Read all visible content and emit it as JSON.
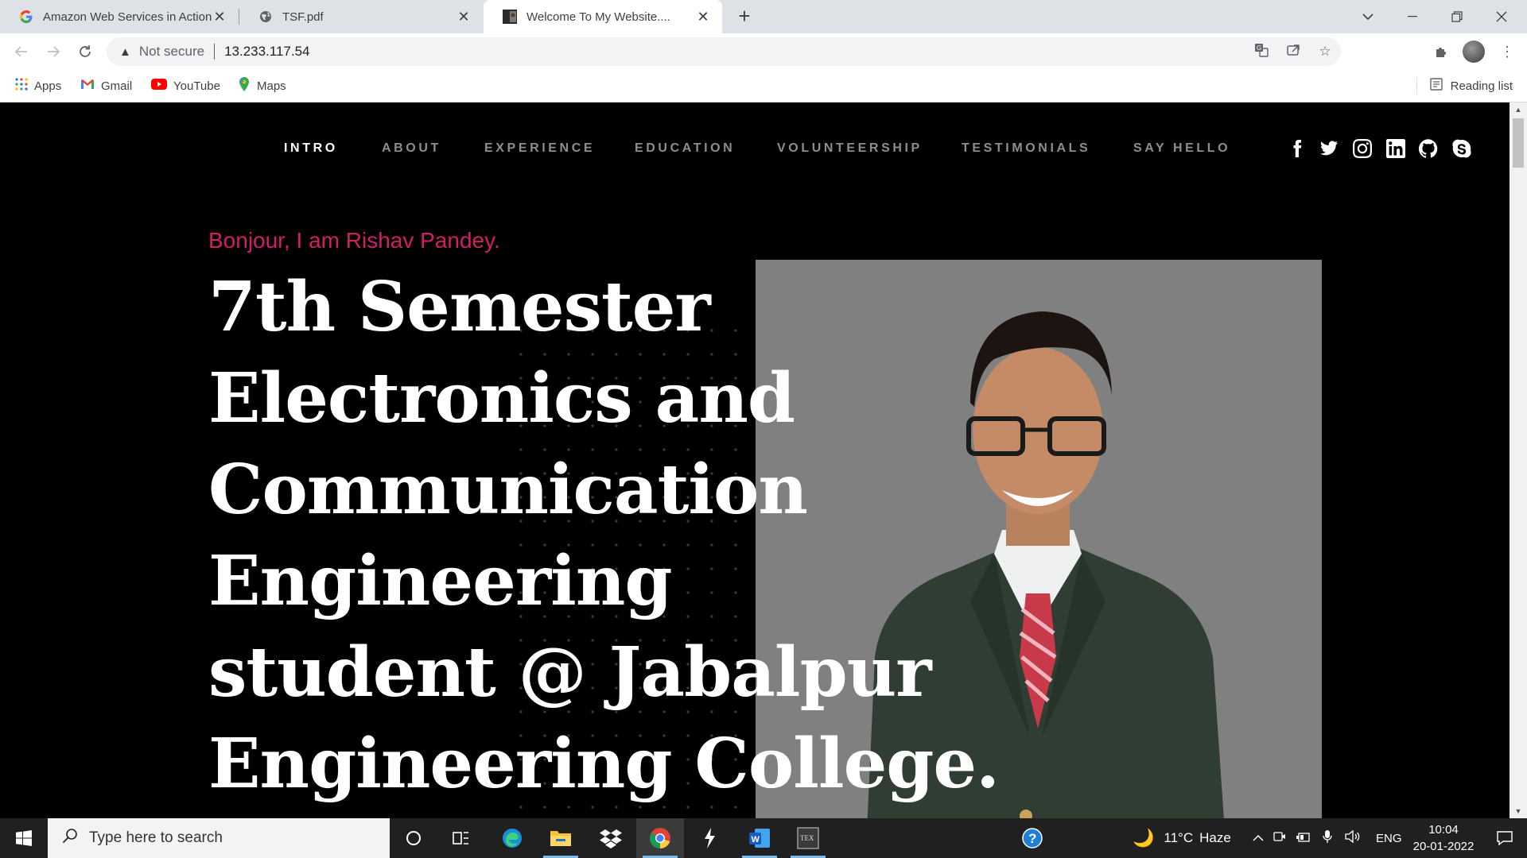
{
  "browser": {
    "tabs": [
      {
        "title": "Amazon Web Services in Action -",
        "favicon": "google-g-icon"
      },
      {
        "title": "TSF.pdf",
        "favicon": "globe-icon"
      },
      {
        "title": "Welcome To My Website....",
        "favicon": "site-thumbnail-icon",
        "active": true
      }
    ],
    "address": {
      "security_label": "Not secure",
      "url": "13.233.117.54"
    },
    "bookmarks": [
      {
        "label": "Apps",
        "icon": "apps-grid-icon"
      },
      {
        "label": "Gmail",
        "icon": "gmail-icon"
      },
      {
        "label": "YouTube",
        "icon": "youtube-icon"
      },
      {
        "label": "Maps",
        "icon": "maps-icon"
      }
    ],
    "reading_list": "Reading list"
  },
  "site": {
    "nav": [
      "INTRO",
      "ABOUT",
      "EXPERIENCE",
      "EDUCATION",
      "VOLUNTEERSHIP",
      "TESTIMONIALS",
      "SAY HELLO"
    ],
    "active_nav": "INTRO",
    "social": [
      "facebook-icon",
      "twitter-icon",
      "instagram-icon",
      "linkedin-icon",
      "github-icon",
      "skype-icon"
    ],
    "greeting": "Bonjour, I am Rishav Pandey.",
    "headline_lines": [
      "7th Semester",
      "Electronics and",
      "Communication",
      "Engineering",
      "student @ Jabalpur",
      "Engineering College."
    ],
    "colors": {
      "accent": "#d01e6b",
      "background": "#000000",
      "photo_bg": "#808080"
    }
  },
  "taskbar": {
    "search_placeholder": "Type here to search",
    "weather": {
      "temp": "11°C",
      "condition": "Haze"
    },
    "language": "ENG",
    "time": "10:04",
    "date": "20-01-2022"
  }
}
